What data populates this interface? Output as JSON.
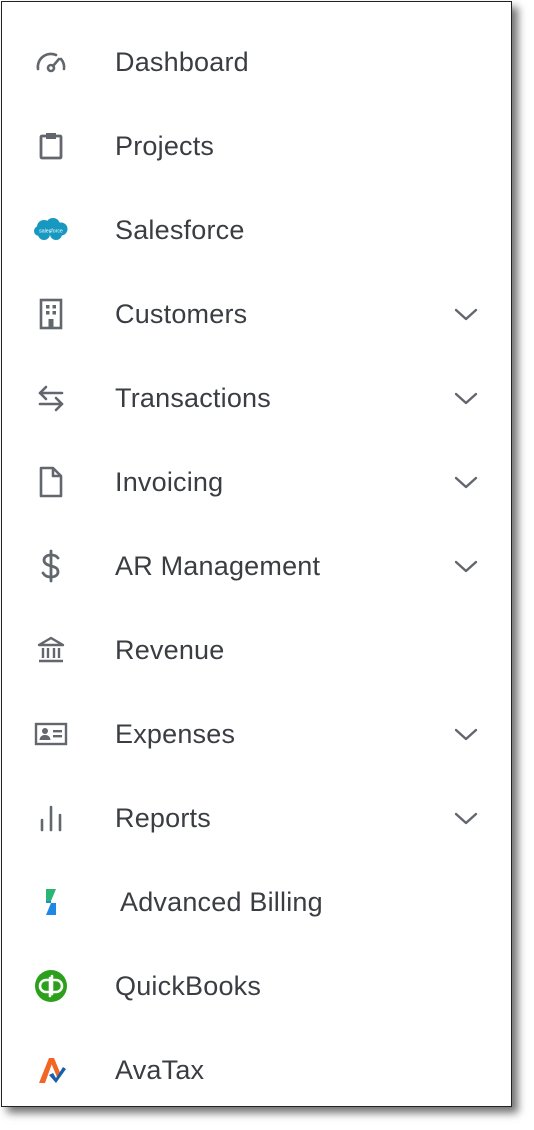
{
  "nav": {
    "items": [
      {
        "label": "Dashboard",
        "icon": "gauge-icon",
        "expandable": false
      },
      {
        "label": "Projects",
        "icon": "clipboard-icon",
        "expandable": false
      },
      {
        "label": "Salesforce",
        "icon": "salesforce-logo-icon",
        "expandable": false
      },
      {
        "label": "Customers",
        "icon": "building-icon",
        "expandable": true
      },
      {
        "label": "Transactions",
        "icon": "arrows-exchange-icon",
        "expandable": true
      },
      {
        "label": "Invoicing",
        "icon": "document-icon",
        "expandable": true
      },
      {
        "label": "AR Management",
        "icon": "dollar-icon",
        "expandable": true
      },
      {
        "label": "Revenue",
        "icon": "bank-icon",
        "expandable": false
      },
      {
        "label": "Expenses",
        "icon": "id-card-icon",
        "expandable": true
      },
      {
        "label": "Reports",
        "icon": "bar-chart-icon",
        "expandable": true
      },
      {
        "label": "Advanced Billing",
        "icon": "advanced-billing-logo-icon",
        "expandable": false
      },
      {
        "label": "QuickBooks",
        "icon": "quickbooks-logo-icon",
        "expandable": false
      },
      {
        "label": "AvaTax",
        "icon": "avatax-logo-icon",
        "expandable": false
      }
    ]
  },
  "salesforce_logo_text": "salesforce",
  "colors": {
    "text": "#3a3d42",
    "icon": "#62666d",
    "salesforce": "#1798c1",
    "quickbooks": "#2ca01c",
    "advanced_billing_green": "#2bb673",
    "advanced_billing_blue": "#1e88e5",
    "avatax_orange": "#f26522",
    "avatax_blue": "#1a5fa8"
  }
}
